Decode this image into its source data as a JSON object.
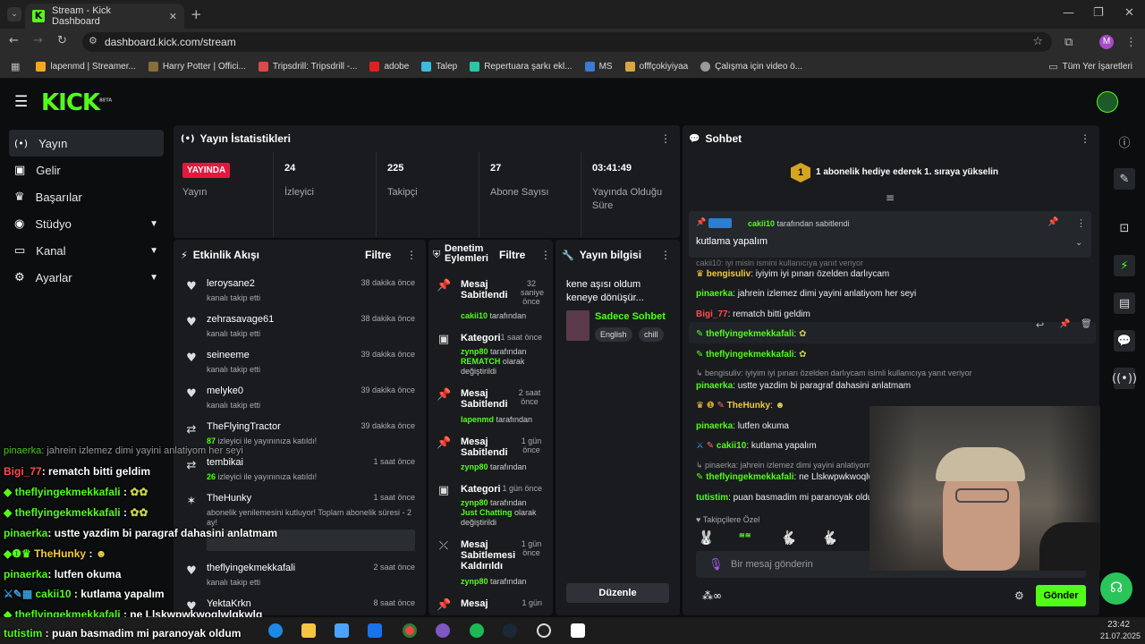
{
  "browser": {
    "tab_title": "Stream - Kick Dashboard",
    "url": "dashboard.kick.com/stream",
    "avatar_letter": "M",
    "bookmarks": [
      "lapenmd | Streamer...",
      "Harry Potter | Offici...",
      "Tripsdrill: Tripsdrill -...",
      "adobe",
      "Talep",
      "Repertuara şarkı ekl...",
      "MS",
      "offfçokiyiyaa",
      "Çalışma için video ö..."
    ],
    "all_bookmarks": "Tüm Yer İşaretleri"
  },
  "nav": {
    "logo": "KICK",
    "beta": "BETA",
    "items": [
      "Yayın",
      "Gelir",
      "Başarılar",
      "Stüdyo",
      "Kanal",
      "Ayarlar"
    ]
  },
  "stats": {
    "title": "Yayın İstatistikleri",
    "live_badge": "YAYINDA",
    "live_label": "Yayın",
    "viewers": "24",
    "viewers_label": "İzleyici",
    "followers": "225",
    "followers_label": "Takipçi",
    "subs": "27",
    "subs_label": "Abone Sayısı",
    "uptime": "03:41:49",
    "uptime_label": "Yayında Olduğu Süre"
  },
  "activity": {
    "title": "Etkinlik Akışı",
    "filter": "Filtre",
    "events": [
      {
        "name": "leroysane2",
        "sub": "kanalı takip etti",
        "time": "38 dakika önce"
      },
      {
        "name": "zehrasavage61",
        "sub": "kanalı takip etti",
        "time": "38 dakika önce"
      },
      {
        "name": "seineeme",
        "sub": "kanalı takip etti",
        "time": "39 dakika önce"
      },
      {
        "name": "melyke0",
        "sub": "kanalı takip etti",
        "time": "39 dakika önce"
      },
      {
        "name": "TheFlyingTractor",
        "sub_num": "87",
        "sub": "izleyici ile yayınınıza katıldı!",
        "time": "39 dakika önce"
      },
      {
        "name": "tembikai",
        "sub_num": "26",
        "sub": "izleyici ile yayınınıza katıldı!",
        "time": "1 saat önce"
      },
      {
        "name": "TheHunky",
        "sub": "abonelik yenilemesini kutluyor! Toplam abonelik süresi - 2 ay!",
        "time": "1 saat önce"
      },
      {
        "name": "theflyingekmekkafali",
        "sub": "kanalı takip etti",
        "time": "2 saat önce"
      },
      {
        "name": "YektaKrkn",
        "sub": "",
        "time": "8 saat önce"
      }
    ]
  },
  "moderation": {
    "title_line1": "Denetim",
    "title_line2": "Eylemleri",
    "filter": "Filtre",
    "by": "tarafından",
    "olarak": "olarak",
    "changed": "değiştirildi",
    "items": [
      {
        "title": "Mesaj Sabitlendi",
        "time": "32 saniye önce",
        "user": "cakii10"
      },
      {
        "title": "Kategori",
        "time": "1 saat önce",
        "user": "zynp80",
        "value": "REMATCH"
      },
      {
        "title": "Mesaj Sabitlendi",
        "time": "2 saat önce",
        "user": "lapenmd"
      },
      {
        "title": "Mesaj Sabitlendi",
        "time": "1 gün önce",
        "user": "zynp80"
      },
      {
        "title": "Kategori",
        "time": "1 gün önce",
        "user": "zynp80",
        "value": "Just Chatting"
      },
      {
        "title": "Mesaj Sabitlemesi Kaldırıldı",
        "time": "1 gün önce",
        "user": "zynp80"
      },
      {
        "title": "Mesaj",
        "time": "1 gün",
        "user": ""
      }
    ]
  },
  "info": {
    "title": "Yayın bilgisi",
    "stream_title": "kene aşısı oldum keneye dönüşür...",
    "category": "Sadece Sohbet",
    "tags": [
      "English",
      "chill"
    ],
    "edit": "Düzenle"
  },
  "chat": {
    "title": "Sohbet",
    "gift_num": "1",
    "gift_banner": "1 abonelik hediye ederek 1. sıraya yükselin",
    "pinned_by_user": "cakii10",
    "pinned_by_text": "tarafından sabitlendi",
    "pinned_msg": "kutlama yapalım",
    "partial": "cakii10: iyi misin ismini kullanıcıya yanıt veriyor",
    "messages": [
      {
        "user": "bengisuliv",
        "text": "iyiyim iyi pınarı özelden darlıycam",
        "color": "#f5c842"
      },
      {
        "user": "pinaerka",
        "text": "jahrein izlemez dimi yayini anlatiyom her seyi",
        "color": "#53fc18"
      },
      {
        "user": "Bigi_77",
        "text": "rematch bitti geldim",
        "color": "#ff4d4d"
      },
      {
        "user": "theflyingekmekkafali",
        "text": "",
        "color": "#53fc18"
      },
      {
        "user": "theflyingekmekkafali",
        "text": "",
        "color": "#53fc18"
      },
      {
        "user": "pinaerka",
        "text": "ustte yazdim bi paragraf dahasini anlatmam",
        "color": "#53fc18"
      },
      {
        "user": "TheHunky",
        "text": "",
        "color": "#f5c842"
      },
      {
        "user": "pinaerka",
        "text": "lutfen okuma",
        "color": "#53fc18"
      },
      {
        "user": "cakii10",
        "text": "kutlama yapalım",
        "color": "#53fc18"
      },
      {
        "user": "theflyingekmekkafali",
        "text": "ne Llskwpwkwoqlwlqkwlq",
        "color": "#53fc18"
      },
      {
        "user": "tutistim",
        "text": "puan basmadim mi paranoyak oldum",
        "color": "#53fc18"
      }
    ],
    "reply1": "bengisuliv: iyiyim iyi pınarı özelden darlıycam isimli kullanıcıya yanıt veriyor",
    "reply2": "pinaerka: jahrein izlemez dimi yayini anlatiyom her seyi isimli kullanıcıya yanıt veriyor",
    "followers_only": "Takipçilere Özel",
    "placeholder": "Bir mesaj gönderin",
    "send": "Gönder"
  },
  "overlay": {
    "lines": [
      {
        "user": "pinaerka",
        "text": ": jahrein izlemez dimi yayini anlatiyom her seyi",
        "color": "#53fc18"
      },
      {
        "user": "Bigi_77",
        "text": ": rematch bitti geldim",
        "color": "#ff4d4d"
      },
      {
        "user": "theflyingekmekkafali",
        "text": " :",
        "color": "#53fc18"
      },
      {
        "user": "theflyingekmekkafali",
        "text": " :",
        "color": "#53fc18"
      },
      {
        "user": "pinaerka",
        "text": ": ustte yazdim bi paragraf dahasini anlatmam",
        "color": "#53fc18"
      },
      {
        "user": "TheHunky",
        "text": " :",
        "color": "#f5c842"
      },
      {
        "user": "pinaerka",
        "text": ": lutfen okuma",
        "color": "#53fc18"
      },
      {
        "user": "cakii10",
        "text": " : kutlama yapalım",
        "color": "#53fc18"
      },
      {
        "user": "theflyingekmekkafali",
        "text": " : ne Llskwpwkwoqlwlqkwlq",
        "color": "#53fc18"
      },
      {
        "user": "tutistim",
        "text": " : puan basmadim mi paranoyak oldum",
        "color": "#53fc18"
      }
    ]
  },
  "clock": {
    "time": "23:42",
    "date": "21.07.2025"
  },
  "colors": {
    "brand": "#53fc18",
    "panel": "#191b1f",
    "live": "#e5173f"
  }
}
